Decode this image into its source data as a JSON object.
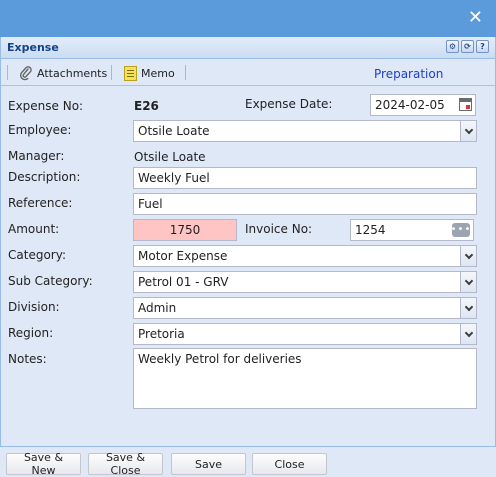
{
  "window": {
    "close_icon": "close-icon"
  },
  "panel": {
    "title": "Expense",
    "tools": [
      "gear-icon",
      "refresh-icon",
      "help-icon"
    ],
    "help_glyph": "?"
  },
  "toolbar": {
    "attachments_label": "Attachments",
    "memo_label": "Memo",
    "status": "Preparation"
  },
  "form": {
    "expense_no_label": "Expense No:",
    "expense_no": "E26",
    "expense_date_label": "Expense Date:",
    "expense_date": "2024-02-05",
    "employee_label": "Employee:",
    "employee": "Otsile Loate",
    "manager_label": "Manager:",
    "manager": "Otsile Loate",
    "description_label": "Description:",
    "description": "Weekly Fuel",
    "reference_label": "Reference:",
    "reference": "Fuel",
    "amount_label": "Amount:",
    "amount": "1750",
    "invoice_no_label": "Invoice No:",
    "invoice_no": "1254",
    "category_label": "Category:",
    "category": "Motor Expense",
    "sub_category_label": "Sub Category:",
    "sub_category": "Petrol 01 - GRV",
    "division_label": "Division:",
    "division": "Admin",
    "region_label": "Region:",
    "region": "Pretoria",
    "notes_label": "Notes:",
    "notes": "Weekly Petrol for deliveries"
  },
  "footer": {
    "save_new": "Save & New",
    "save_close": "Save & Close",
    "save": "Save",
    "close": "Close"
  },
  "colors": {
    "titlebar": "#5b9bdb",
    "panel_bg": "#dfe8f6",
    "amount_bg": "#ffc4c4",
    "status_link": "#1a3fd4"
  }
}
